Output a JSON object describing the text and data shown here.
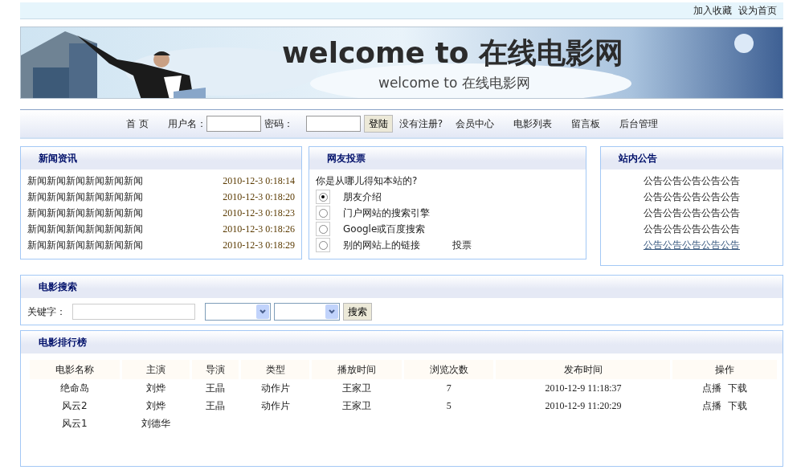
{
  "top_links": [
    "加入收藏",
    "设为首页"
  ],
  "banner": {
    "title": "welcome to 在线电影网",
    "subtitle": "welcome to 在线电影网"
  },
  "nav": {
    "home": "首 页",
    "username_label": "用户名：",
    "password_label": "密码：",
    "login_button": "登陆",
    "register": "没有注册?",
    "links": [
      "会员中心",
      "电影列表",
      "留言板",
      "后台管理"
    ]
  },
  "news": {
    "title": "新闻资讯",
    "items": [
      {
        "text": "新闻新闻新闻新闻新闻新闻",
        "time": "2010-12-3 0:18:14"
      },
      {
        "text": "新闻新闻新闻新闻新闻新闻",
        "time": "2010-12-3 0:18:20"
      },
      {
        "text": "新闻新闻新闻新闻新闻新闻",
        "time": "2010-12-3 0:18:23"
      },
      {
        "text": "新闻新闻新闻新闻新闻新闻",
        "time": "2010-12-3 0:18:26"
      },
      {
        "text": "新闻新闻新闻新闻新闻新闻",
        "time": "2010-12-3 0:18:29"
      }
    ]
  },
  "poll": {
    "title": "网友投票",
    "question": "你是从哪儿得知本站的?",
    "options": [
      {
        "label": "朋友介绍",
        "selected": true
      },
      {
        "label": "门户网站的搜索引擎",
        "selected": false
      },
      {
        "label": "Google或百度搜索",
        "selected": false
      },
      {
        "label": "别的网站上的链接",
        "selected": false
      }
    ],
    "vote": "投票"
  },
  "notices": {
    "title": "站内公告",
    "items": [
      {
        "text": "公告公告公告公告公告",
        "hovered": false
      },
      {
        "text": "公告公告公告公告公告",
        "hovered": false
      },
      {
        "text": "公告公告公告公告公告",
        "hovered": false
      },
      {
        "text": "公告公告公告公告公告",
        "hovered": false
      },
      {
        "text": "公告公告公告公告公告",
        "hovered": true
      }
    ]
  },
  "search": {
    "title": "电影搜索",
    "keyword_label": "关键字：",
    "button": "搜索"
  },
  "ranking": {
    "title": "电影排行榜",
    "columns": [
      "电影名称",
      "主演",
      "导演",
      "类型",
      "播放时间",
      "浏览次数",
      "发布时间",
      "操作"
    ],
    "rows": [
      {
        "cells": [
          "绝命岛",
          "刘烨",
          "王晶",
          "动作片",
          "王家卫",
          "7",
          "2010-12-9 11:18:37"
        ],
        "actions": [
          "点播",
          "下载"
        ]
      },
      {
        "cells": [
          "风云2",
          "刘烨",
          "王晶",
          "动作片",
          "王家卫",
          "5",
          "2010-12-9 11:20:29"
        ],
        "actions": [
          "点播",
          "下载"
        ]
      },
      {
        "cells": [
          "风云1",
          "刘德华"
        ],
        "actions": []
      }
    ]
  }
}
